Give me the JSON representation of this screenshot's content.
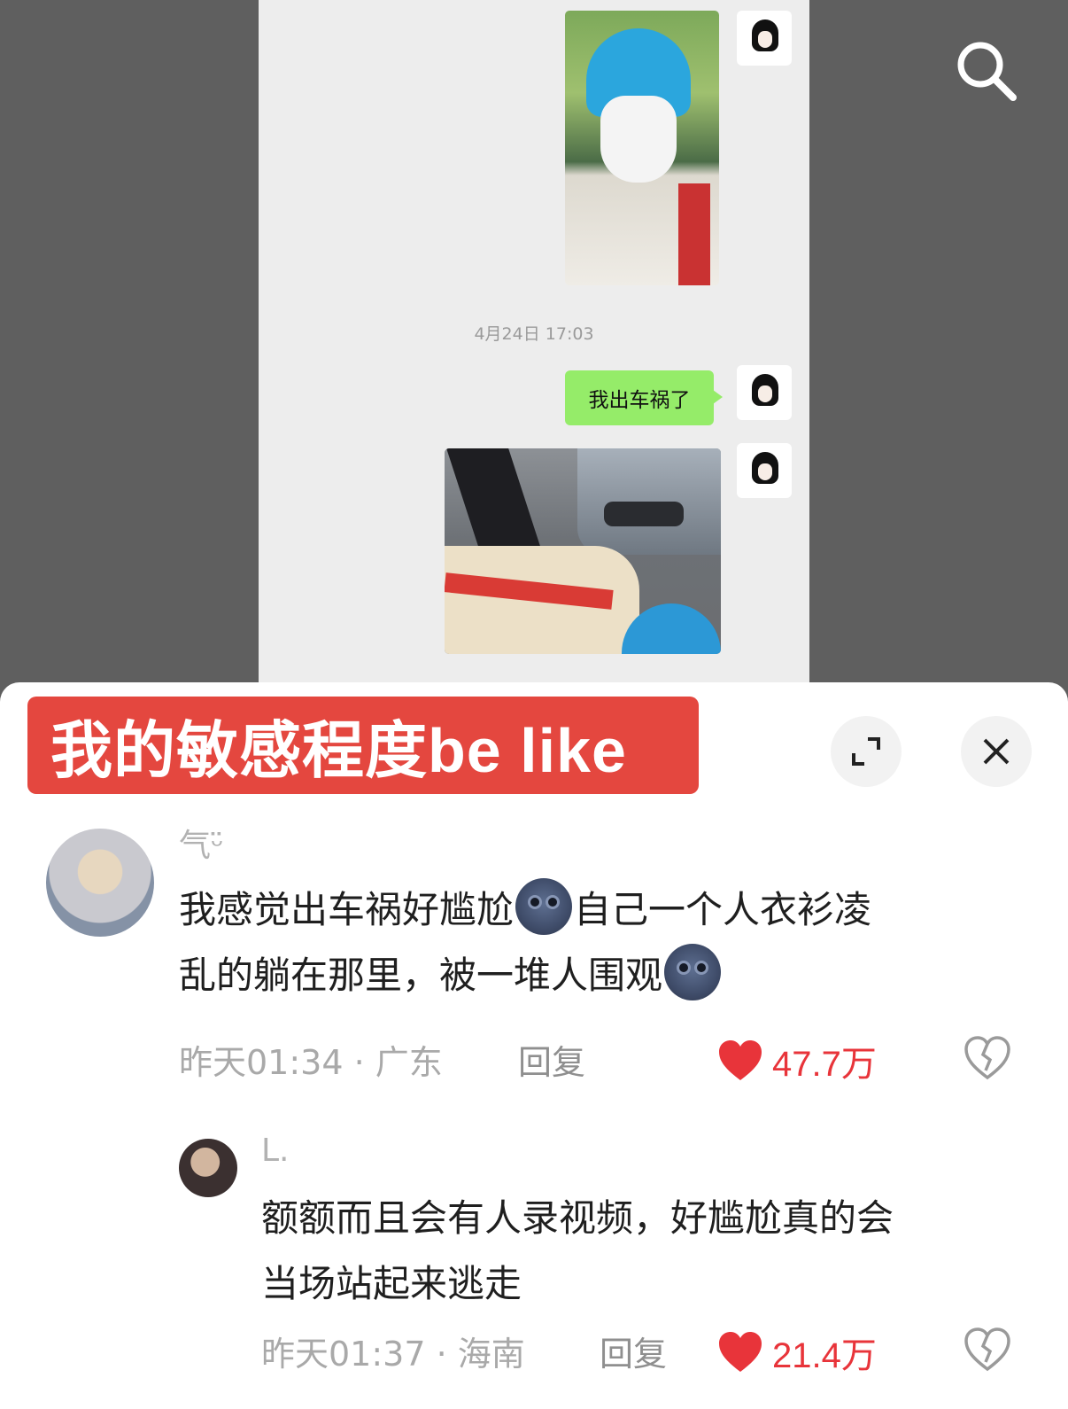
{
  "chat": {
    "timestamp": "4月24日 17:03",
    "message": "我出车祸了"
  },
  "video": {
    "caption": "我的敏感程度be like"
  },
  "comments": [
    {
      "user": "气ᵕ̈",
      "text_line1": "我感觉出车祸好尴尬",
      "text_line1b": "自己一个人衣衫凌",
      "text_line2": "乱的躺在那里，被一堆人围观",
      "time": "昨天01:34",
      "location": "广东",
      "reply_label": "回复",
      "likes": "47.7万"
    },
    {
      "user": "L.",
      "text_line1": "额额而且会有人录视频，好尴尬真的会",
      "text_line2": "当场站起来逃走",
      "time": "昨天01:37",
      "location": "海南",
      "reply_label": "回复",
      "likes": "21.4万"
    }
  ],
  "icons": {
    "emoji": "moon-face-emoji",
    "search": "search-icon",
    "expand": "expand-icon",
    "close": "close-icon",
    "like": "heart-icon",
    "dislike": "broken-heart-icon"
  },
  "colors": {
    "caption_bg": "#e4473f",
    "like": "#e8343a",
    "chat_bubble": "#95ec69"
  }
}
